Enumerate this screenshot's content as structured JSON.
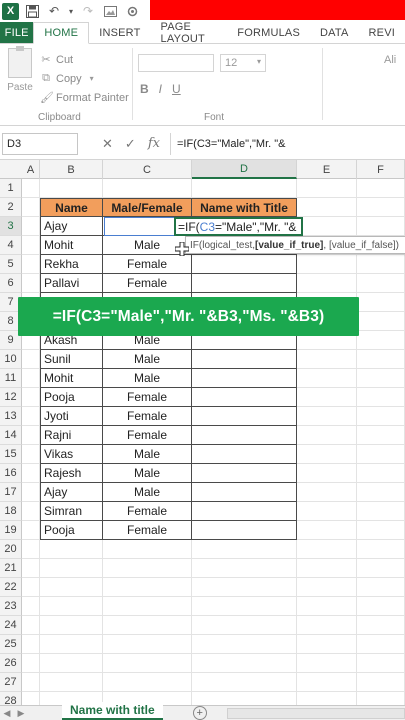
{
  "quick_access": {
    "app_icon": "X",
    "icons": [
      "save-icon",
      "undo-icon",
      "redo-icon",
      "image-icon",
      "camera-icon"
    ]
  },
  "ribbon_tabs": [
    "FILE",
    "HOME",
    "INSERT",
    "PAGE LAYOUT",
    "FORMULAS",
    "DATA",
    "REVI"
  ],
  "clipboard": {
    "paste_label": "Paste",
    "cut_label": "Cut",
    "copy_label": "Copy",
    "format_painter_label": "Format Painter",
    "group_label": "Clipboard"
  },
  "font": {
    "size": "12",
    "group_label": "Font",
    "bold": "B",
    "italic": "I",
    "underline": "U"
  },
  "alignment": {
    "label": "Ali"
  },
  "formula_bar": {
    "name_box": "D3",
    "cancel": "✕",
    "enter": "✓",
    "fx": "fx",
    "formula": "=IF(C3=\"Male\",\"Mr. \"&"
  },
  "columns": [
    "A",
    "B",
    "C",
    "D",
    "E",
    "F"
  ],
  "rows": [
    "1",
    "2",
    "3",
    "4",
    "5",
    "6",
    "7",
    "8",
    "9",
    "10",
    "11",
    "12",
    "13",
    "14",
    "15",
    "16",
    "17",
    "18",
    "19",
    "20",
    "21",
    "22",
    "23",
    "24",
    "25",
    "26",
    "27",
    "28"
  ],
  "table": {
    "headers": [
      "Name",
      "Male/Female",
      "Name with Title"
    ],
    "names": [
      "Ajay",
      "Mohit",
      "Rekha",
      "Pallavi",
      "",
      "",
      "Akash",
      "Sunil",
      "Mohit",
      "Pooja",
      "Jyoti",
      "Rajni",
      "Vikas",
      "Rajesh",
      "Ajay",
      "Simran",
      "Pooja"
    ],
    "genders": [
      "",
      "Male",
      "Female",
      "Female",
      "",
      "",
      "Male",
      "Male",
      "Male",
      "Female",
      "Female",
      "Female",
      "Male",
      "Male",
      "Male",
      "Female",
      "Female"
    ]
  },
  "editing_cell": {
    "prefix": "=IF(",
    "ref": "C3",
    "suffix": "=\"Male\",\"Mr. \"&"
  },
  "tooltip": {
    "part1": "IF(logical_test, ",
    "bold": "[value_if_true]",
    "part2": ", [value_if_false])"
  },
  "banner_text": "=IF(C3=\"Male\",\"Mr. \"&B3,\"Ms. \"&B3)",
  "sheet": {
    "tab_label": "Name with title",
    "add": "+"
  },
  "colors": {
    "excel_green": "#217346",
    "header_orange": "#f29e5c",
    "banner_green": "#1ba84f",
    "ref_blue": "#4a7ed0",
    "title_red": "#ff0000"
  }
}
